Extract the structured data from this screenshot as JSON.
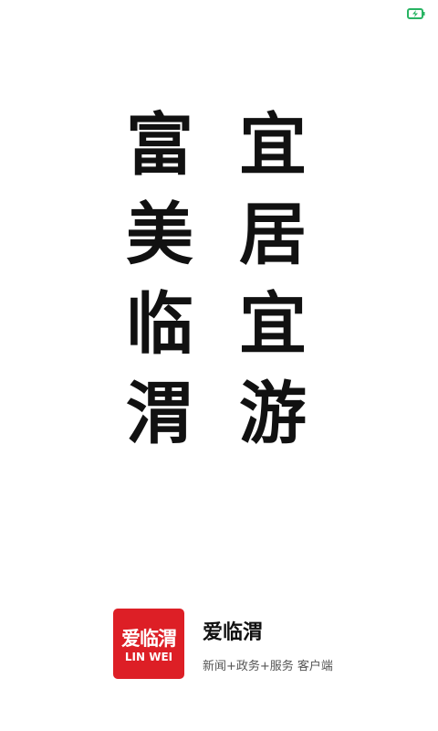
{
  "status_bar": {
    "icon": "battery-icon",
    "icon_color": "#28b463"
  },
  "slogan": {
    "left_column": [
      "富",
      "美",
      "临",
      "渭"
    ],
    "right_column": [
      "宜",
      "居",
      "宜",
      "游"
    ]
  },
  "footer": {
    "app_icon": {
      "name": "爱临渭",
      "subtitle": "LIN WEI",
      "background_color": "#dd1f26"
    },
    "app_name": "爱临渭",
    "tagline": "新闻+政务+服务 客户端"
  }
}
